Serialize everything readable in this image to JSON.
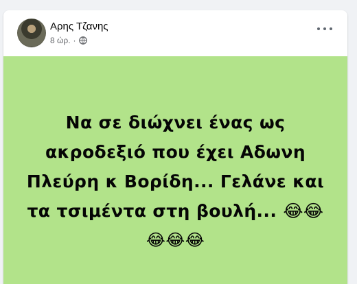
{
  "post": {
    "author": "Αρης Τζανης",
    "time": "8 ώρ.",
    "separator": "·",
    "privacy_icon": "globe-icon",
    "more_icon": "more-options-icon",
    "background_color": "#b2e38a",
    "text_lines": [
      "Να σε διώχνει ένας ως",
      "ακροδεξιό που έχει Αδωνη",
      "Πλεύρη κ Βορίδη... Γελάνε και",
      "τα τσιμέντα στη βουλή... 😂😂",
      "😂😂😂"
    ]
  }
}
